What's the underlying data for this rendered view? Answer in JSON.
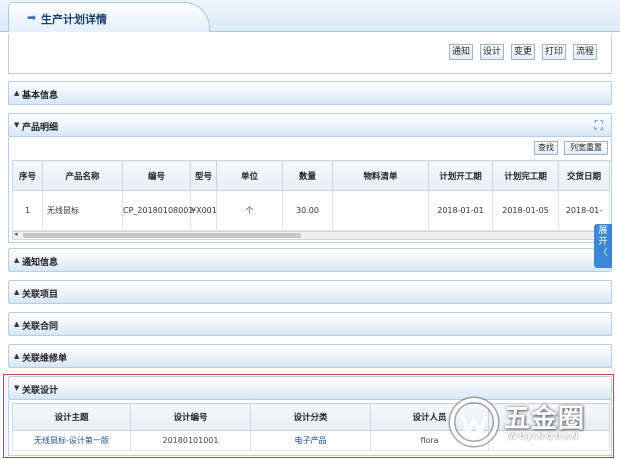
{
  "header": {
    "title": "生产计划详情"
  },
  "toolbar": {
    "buttons": [
      "通知",
      "设计",
      "变更",
      "打印",
      "流程"
    ]
  },
  "sections": {
    "basic_info": "基本信息",
    "product_detail": "产品明细",
    "notice_info": "通知信息",
    "related_project": "关联项目",
    "related_contract": "关联合同",
    "related_repair": "关联维修单",
    "related_design": "关联设计"
  },
  "product_grid": {
    "find_label": "查找",
    "reset_label": "列宽重置",
    "columns": [
      "序号",
      "产品名称",
      "编号",
      "型号",
      "单位",
      "数量",
      "物料清单",
      "计划开工期",
      "计划完工期",
      "交货日期"
    ],
    "rows": [
      [
        "1",
        "无线鼠标",
        "CP_20180108001",
        "¥X001",
        "个",
        "30.00",
        "",
        "2018-01-01",
        "2018-01-05",
        "2018-01-"
      ]
    ]
  },
  "expand_tab": {
    "chars": [
      "展",
      "开",
      "〈"
    ]
  },
  "design_grid": {
    "columns": [
      "设计主题",
      "设计编号",
      "设计分类",
      "设计人员",
      ""
    ],
    "rows": [
      [
        "无线鼠标-设计第一版",
        "20180101001",
        "电子产品",
        "flora",
        ""
      ]
    ]
  },
  "watermark": {
    "cn": "五金圈",
    "en": "WUJINQUAN"
  },
  "colors": {
    "accent": "#3d87d6",
    "highlight_border": "#e03a3a",
    "header_text": "#1a3f6f"
  }
}
